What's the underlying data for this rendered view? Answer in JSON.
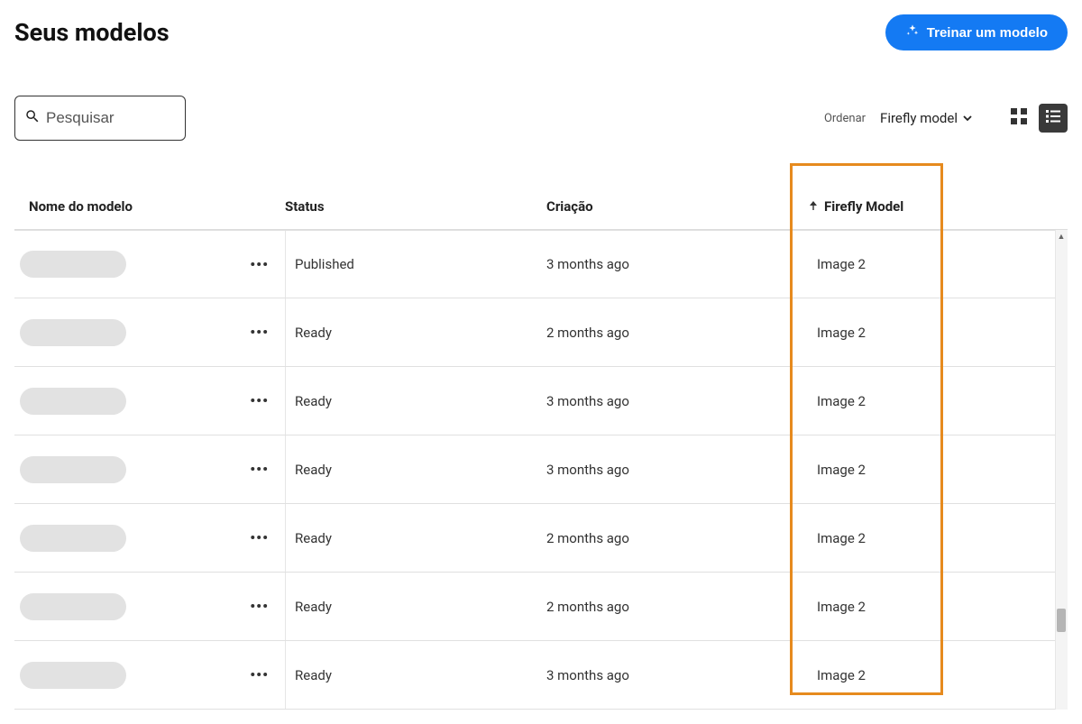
{
  "header": {
    "title": "Seus modelos",
    "train_button": "Treinar um modelo"
  },
  "search": {
    "placeholder": "Pesquisar"
  },
  "sort": {
    "label": "Ordenar",
    "selected": "Firefly model"
  },
  "table": {
    "columns": {
      "name": "Nome do modelo",
      "status": "Status",
      "created": "Criação",
      "firefly": "Firefly Model"
    },
    "rows": [
      {
        "status": "Published",
        "created": "3 months ago",
        "firefly": "Image 2"
      },
      {
        "status": "Ready",
        "created": "2 months ago",
        "firefly": "Image 2"
      },
      {
        "status": "Ready",
        "created": "3 months ago",
        "firefly": "Image 2"
      },
      {
        "status": "Ready",
        "created": "3 months ago",
        "firefly": "Image 2"
      },
      {
        "status": "Ready",
        "created": "2 months ago",
        "firefly": "Image 2"
      },
      {
        "status": "Ready",
        "created": "2 months ago",
        "firefly": "Image 2"
      },
      {
        "status": "Ready",
        "created": "3 months ago",
        "firefly": "Image 2"
      }
    ]
  }
}
